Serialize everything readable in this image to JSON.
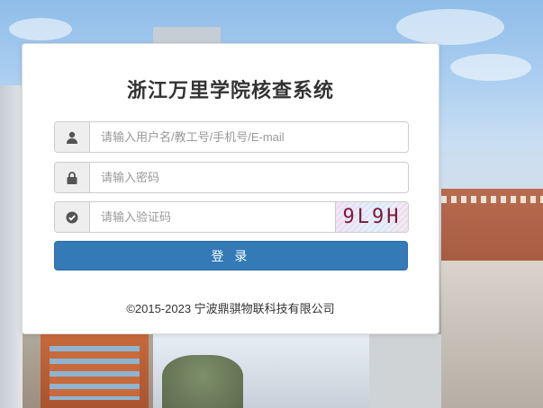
{
  "login": {
    "title": "浙江万里学院核查系统",
    "username": {
      "placeholder": "请输入用户名/教工号/手机号/E-mail",
      "value": "",
      "icon": "user-icon"
    },
    "password": {
      "placeholder": "请输入密码",
      "value": "",
      "icon": "lock-icon"
    },
    "captcha": {
      "placeholder": "请输入验证码",
      "value": "",
      "icon": "check-circle-icon",
      "image_text": "9L9H"
    },
    "submit_label": "登 录",
    "footer": "©2015-2023 宁波鼎骐物联科技有限公司"
  },
  "colors": {
    "primary": "#337ab7",
    "addon_bg": "#eeeeee",
    "title": "#333333"
  }
}
